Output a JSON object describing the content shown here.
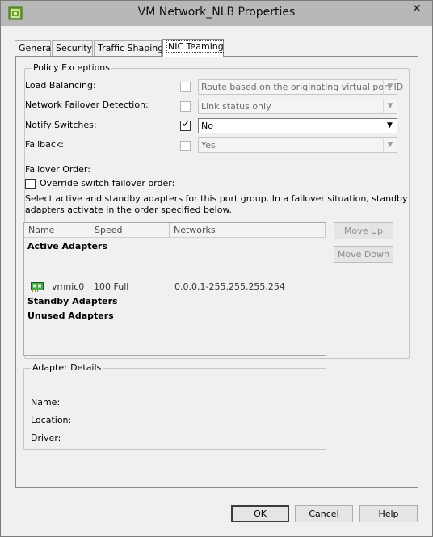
{
  "window": {
    "title": "VM Network_NLB Properties",
    "close_glyph": "✕"
  },
  "tabs": [
    {
      "label": "General"
    },
    {
      "label": "Security"
    },
    {
      "label": "Traffic Shaping"
    },
    {
      "label": "NIC Teaming"
    }
  ],
  "policy": {
    "legend": "Policy Exceptions",
    "rows": [
      {
        "label": "Load Balancing:",
        "checked": false,
        "value": "Route based on the originating virtual port ID",
        "enabled": false
      },
      {
        "label": "Network Failover Detection:",
        "checked": false,
        "value": "Link status only",
        "enabled": false
      },
      {
        "label": "Notify Switches:",
        "checked": true,
        "value": "No",
        "enabled": true
      },
      {
        "label": "Failback:",
        "checked": false,
        "value": "Yes",
        "enabled": false
      }
    ],
    "failover_order_label": "Failover Order:",
    "override_label": "Override switch failover order:",
    "override_checked": false,
    "description_line1": "Select active and standby adapters for this port group.  In a failover situation, standby",
    "description_line2": "adapters activate  in the order specified below."
  },
  "adapters": {
    "columns": [
      "Name",
      "Speed",
      "Networks"
    ],
    "active_header": "Active Adapters",
    "active": [
      {
        "name": "vmnic0",
        "speed": "100 Full",
        "networks": "0.0.0.1-255.255.255.254"
      }
    ],
    "standby_header": "Standby Adapters",
    "unused_header": "Unused Adapters"
  },
  "buttons": {
    "move_up": "Move Up",
    "move_down": "Move Down",
    "ok": "OK",
    "cancel": "Cancel",
    "help": "Help"
  },
  "details": {
    "legend": "Adapter Details",
    "name_label": "Name:",
    "location_label": "Location:",
    "driver_label": "Driver:"
  },
  "colors": {
    "titlebar": "#b8b8b8",
    "window_bg": "#f0f0f0",
    "nic_green": "#2e8b2e"
  }
}
